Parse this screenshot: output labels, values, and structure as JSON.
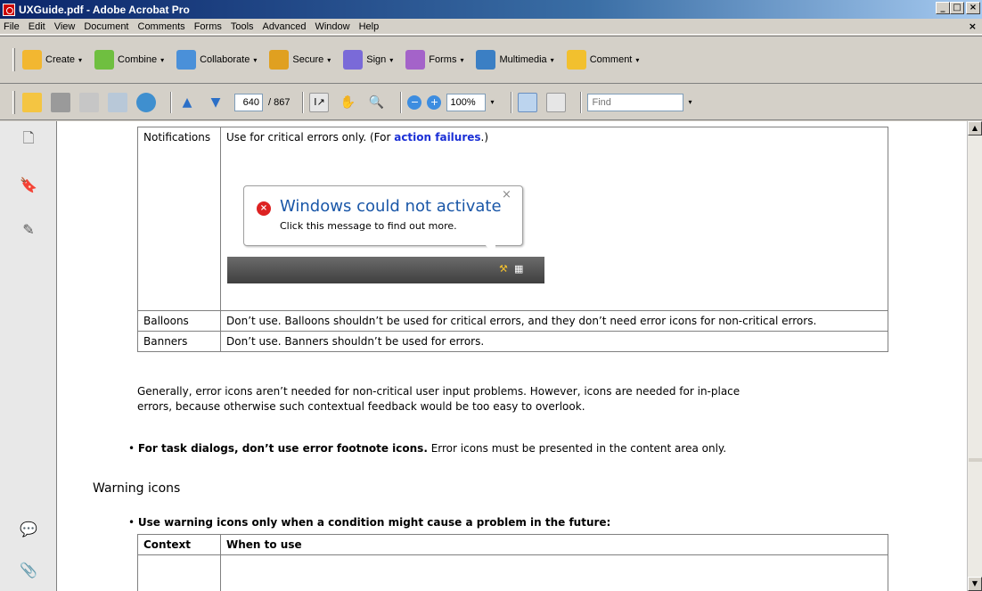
{
  "window": {
    "title": "UXGuide.pdf - Adobe Acrobat Pro",
    "min_label": "_",
    "max_label": "□",
    "close_label": "×"
  },
  "menu": {
    "items": [
      "File",
      "Edit",
      "View",
      "Document",
      "Comments",
      "Forms",
      "Tools",
      "Advanced",
      "Window",
      "Help"
    ],
    "close_label": "×"
  },
  "task_toolbar": {
    "buttons": [
      {
        "label": "Create",
        "icon": "create-icon",
        "color": "#f2b731"
      },
      {
        "label": "Combine",
        "icon": "combine-icon",
        "color": "#6fbf40"
      },
      {
        "label": "Collaborate",
        "icon": "collaborate-icon",
        "color": "#4a90d9"
      },
      {
        "label": "Secure",
        "icon": "lock-icon",
        "color": "#e0a020"
      },
      {
        "label": "Sign",
        "icon": "pen-icon",
        "color": "#7a6ad8"
      },
      {
        "label": "Forms",
        "icon": "forms-icon",
        "color": "#a463c9"
      },
      {
        "label": "Multimedia",
        "icon": "multimedia-icon",
        "color": "#3b7fc4"
      },
      {
        "label": "Comment",
        "icon": "comment-icon",
        "color": "#f2c02e"
      }
    ],
    "dropdown_glyph": "▾"
  },
  "nav_toolbar": {
    "page_current": "640",
    "page_total": "/ 867",
    "zoom": "100%",
    "find_placeholder": "Find",
    "dropdown_glyph": "▾"
  },
  "document": {
    "notif_table": {
      "rows": [
        {
          "context": "Notifications",
          "use_text": "Use for critical errors only. (For ",
          "link": "action failures",
          "use_suffix": ".)"
        },
        {
          "context": "Balloons",
          "use_text": "Don’t use. Balloons shouldn’t be used for critical errors, and they don’t need error icons for non-critical errors."
        },
        {
          "context": "Banners",
          "use_text": "Don’t use. Banners shouldn’t be used for errors."
        }
      ]
    },
    "notification": {
      "title": "Windows could not activate",
      "text": "Click this message to find out more.",
      "close_glyph": "×",
      "error_glyph": "×"
    },
    "paragraph1_line1": "Generally, error icons aren’t needed for non-critical user input problems. However, icons are needed for in-place",
    "paragraph1_line2": "errors, because otherwise such contextual feedback would be too easy to overlook.",
    "bullet1_bold": "For task dialogs, don’t use error footnote icons.",
    "bullet1_rest": " Error icons must be presented in the content area only.",
    "heading": "Warning icons",
    "bullet2_bold": "Use warning icons only when a condition might cause a problem in the future:",
    "warning_table": {
      "headers": [
        "Context",
        "When to use"
      ]
    }
  },
  "scrollbar": {
    "up_glyph": "▲",
    "down_glyph": "▼"
  }
}
